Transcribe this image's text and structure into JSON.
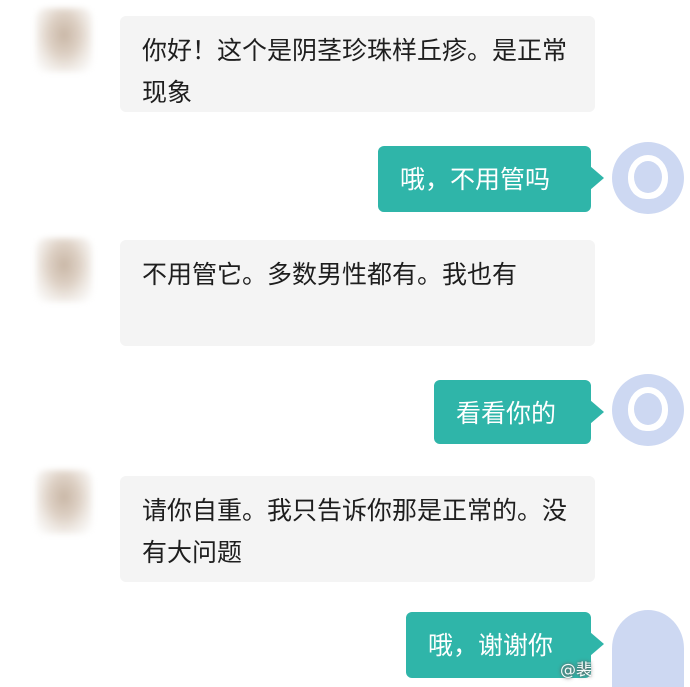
{
  "messages": [
    {
      "side": "left",
      "text": "你好！这个是阴茎珍珠样丘疹。是正常现象"
    },
    {
      "side": "right",
      "text": "哦，不用管吗"
    },
    {
      "side": "left",
      "text": "不用管它。多数男性都有。我也有"
    },
    {
      "side": "right",
      "text": "看看你的"
    },
    {
      "side": "left",
      "text": "请你自重。我只告诉你那是正常的。没有大问题"
    },
    {
      "side": "right",
      "text": "哦，谢谢你"
    }
  ],
  "watermark": "@裴",
  "colors": {
    "bubble_right": "#2fb5a9",
    "bubble_left": "#f4f4f4",
    "avatar_right": "#cdd8f2"
  },
  "icons": {
    "left_avatar": "blurred-profile-avatar",
    "right_avatar": "default-user-avatar"
  }
}
